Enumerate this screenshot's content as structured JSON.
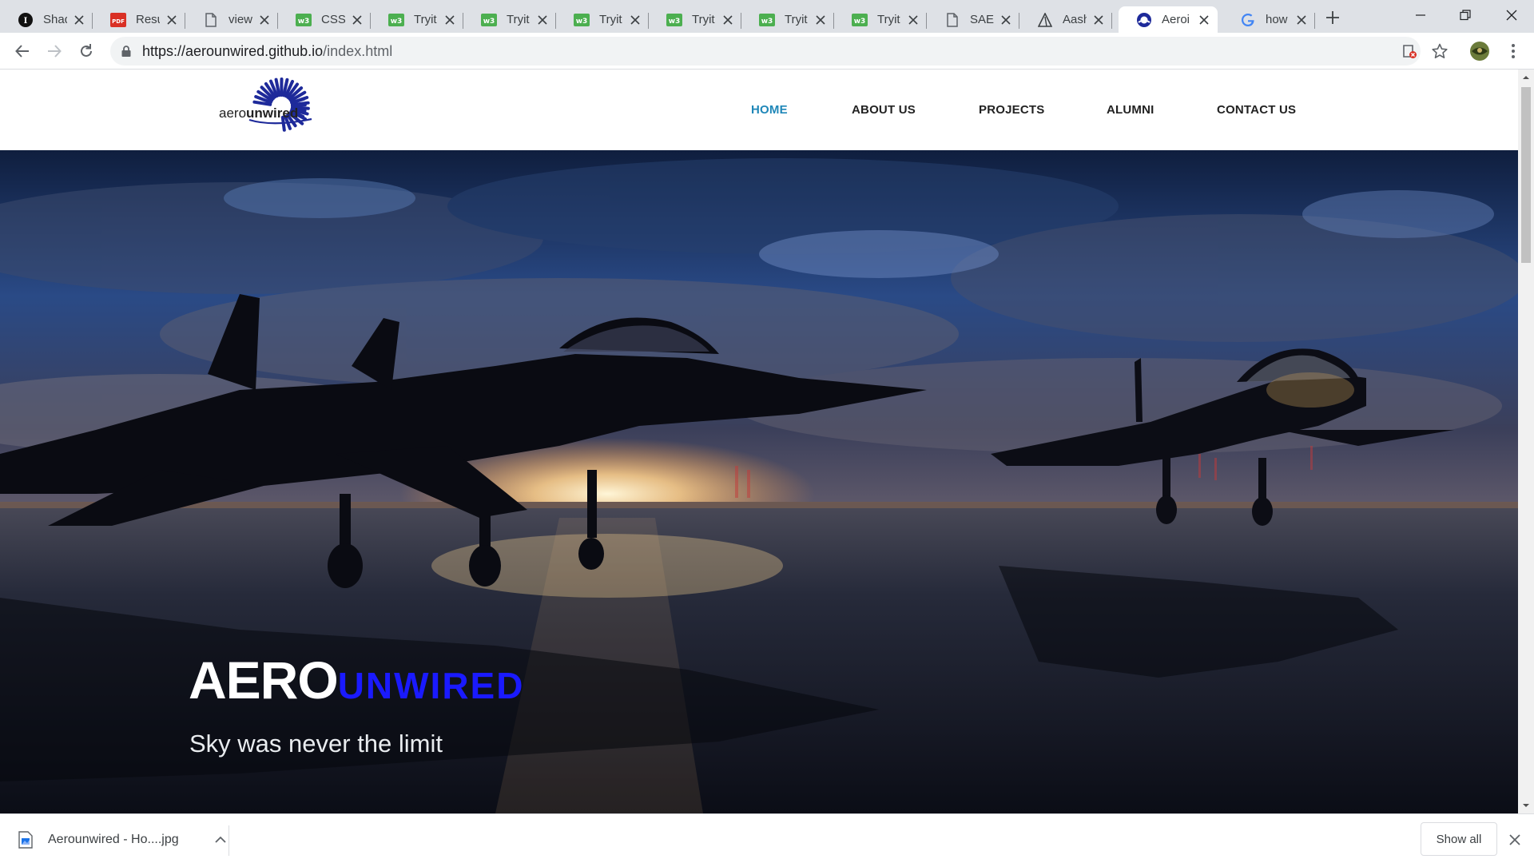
{
  "browser": {
    "tabs": [
      {
        "title": "Shady",
        "favicon": "instapaper-icon"
      },
      {
        "title": "Resum",
        "favicon": "pdf-icon"
      },
      {
        "title": "view-",
        "favicon": "document-icon"
      },
      {
        "title": "CSS T",
        "favicon": "w3schools-icon"
      },
      {
        "title": "Tryit E",
        "favicon": "w3schools-icon"
      },
      {
        "title": "Tryit E",
        "favicon": "w3schools-icon"
      },
      {
        "title": "Tryit E",
        "favicon": "w3schools-icon"
      },
      {
        "title": "Tryit E",
        "favicon": "w3schools-icon"
      },
      {
        "title": "Tryit E",
        "favicon": "w3schools-icon"
      },
      {
        "title": "Tryit E",
        "favicon": "w3schools-icon"
      },
      {
        "title": "SAE In",
        "favicon": "document-icon"
      },
      {
        "title": "Aashi",
        "favicon": "triangle-icon"
      },
      {
        "title": "Aeroi",
        "favicon": "aerounwired-icon",
        "active": true
      },
      {
        "title": "how t",
        "favicon": "google-icon"
      }
    ],
    "url_host": "https://aerounwired.github.io",
    "url_path": "/index.html"
  },
  "site": {
    "logo": {
      "text_light": "aero",
      "text_bold": "unwired"
    },
    "nav": [
      "HOME",
      "ABOUT US",
      "PROJECTS",
      "ALUMNI",
      "CONTACT US"
    ],
    "active_nav": "HOME",
    "hero": {
      "title_main": "AERO",
      "title_accent": "UNWIRED",
      "subtitle": "Sky was never the limit"
    }
  },
  "downloads": {
    "file_name": "Aerounwired - Ho....jpg",
    "show_all_label": "Show all"
  },
  "colors": {
    "nav_active": "#1f87b8",
    "title_accent": "#1a1aff",
    "logo_blue": "#1e2a9a",
    "chrome_bg": "#dee1e6",
    "w3schools_green": "#4caf50"
  }
}
